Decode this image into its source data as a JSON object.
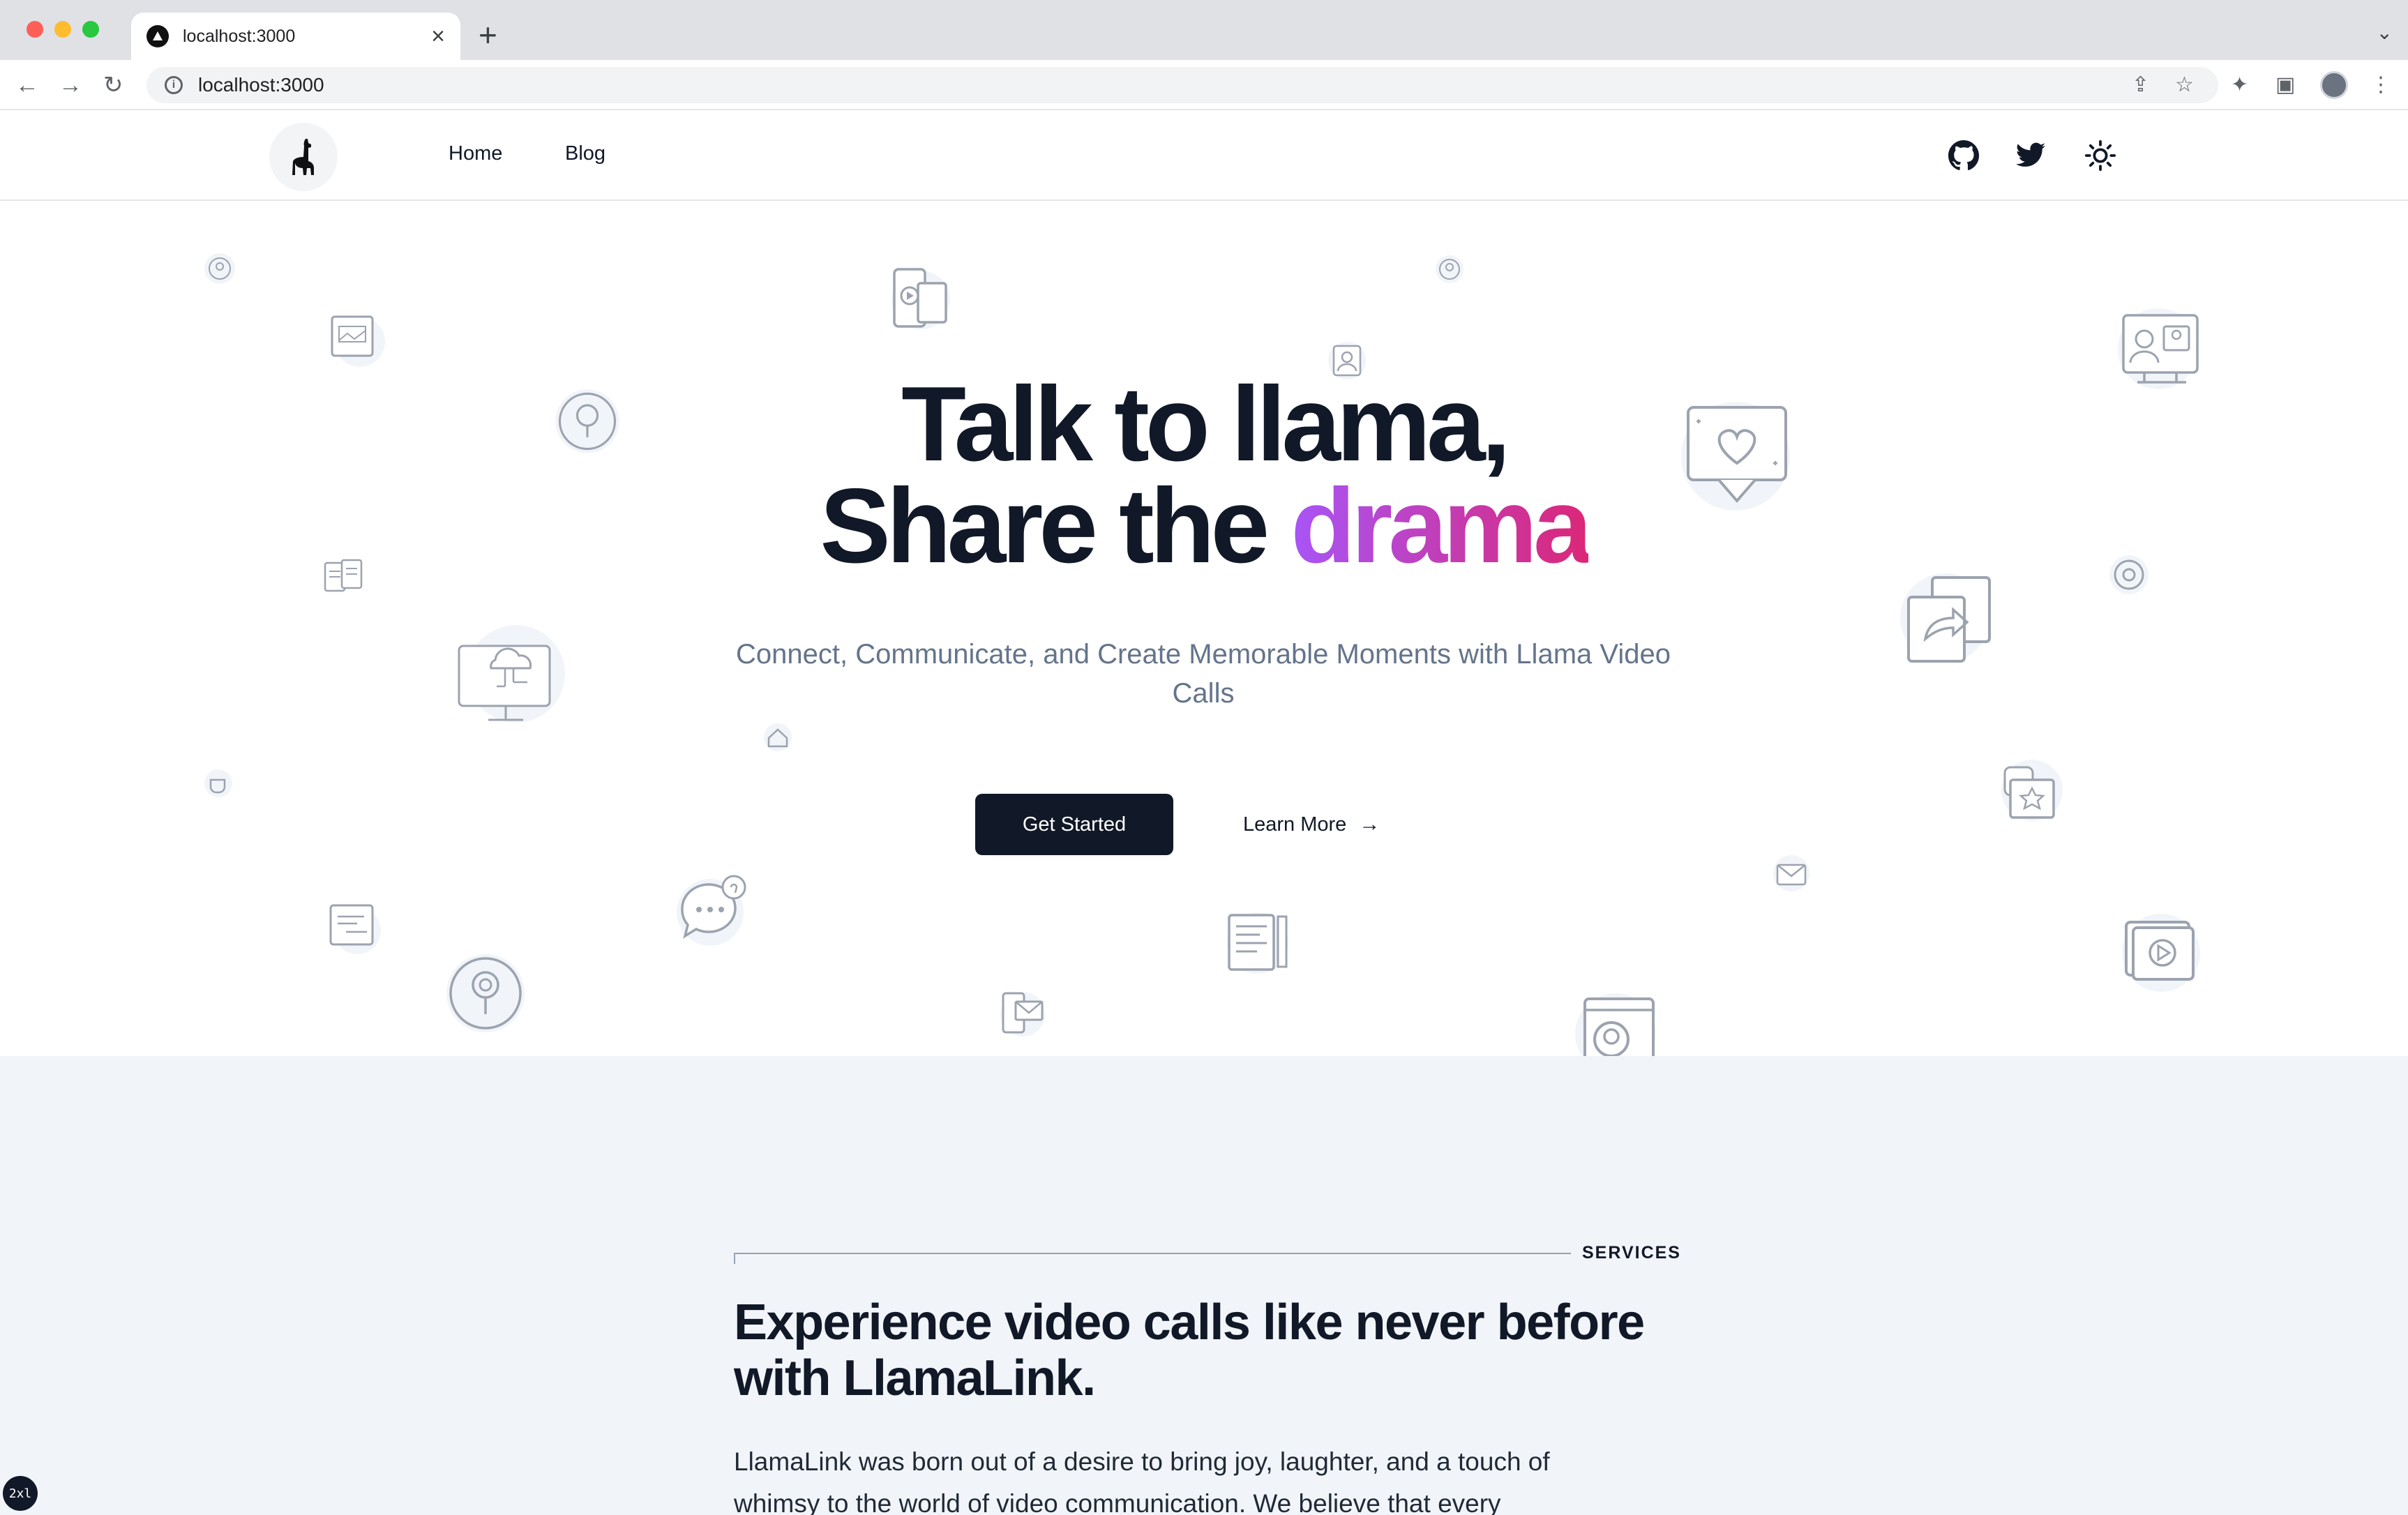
{
  "browser": {
    "tab_title": "localhost:3000",
    "tab_close": "×",
    "new_tab": "+",
    "tab_menu": "⌄",
    "url": "localhost:3000",
    "info_icon": "i",
    "back": "←",
    "forward": "→",
    "reload": "↻",
    "share": "⇪",
    "bookmark": "☆",
    "extensions": "✦",
    "side_panel": "▣",
    "menu": "⋮"
  },
  "header": {
    "nav": [
      {
        "label": "Home"
      },
      {
        "label": "Blog"
      }
    ]
  },
  "hero": {
    "headline_line1": "Talk to llama,",
    "headline_line2_prefix": "Share the ",
    "headline_line2_accent": "drama",
    "subheadline": "Connect, Communicate, and Create Memorable Moments with Llama Video Calls",
    "primary_cta": "Get Started",
    "secondary_cta": "Learn More",
    "secondary_cta_arrow": "→"
  },
  "services": {
    "eyebrow": "SERVICES",
    "title": "Experience video calls like never before with LlamaLink.",
    "body": "LlamaLink was born out of a desire to bring joy, laughter, and a touch of whimsy to the world of video communication. We believe that every"
  },
  "devtools_badge": "2xl",
  "colors": {
    "primary": "#111827",
    "accent_gradient_start": "#a855f7",
    "accent_gradient_end": "#db2777",
    "section_bg": "#f1f5f9",
    "muted_text": "#64748b"
  }
}
